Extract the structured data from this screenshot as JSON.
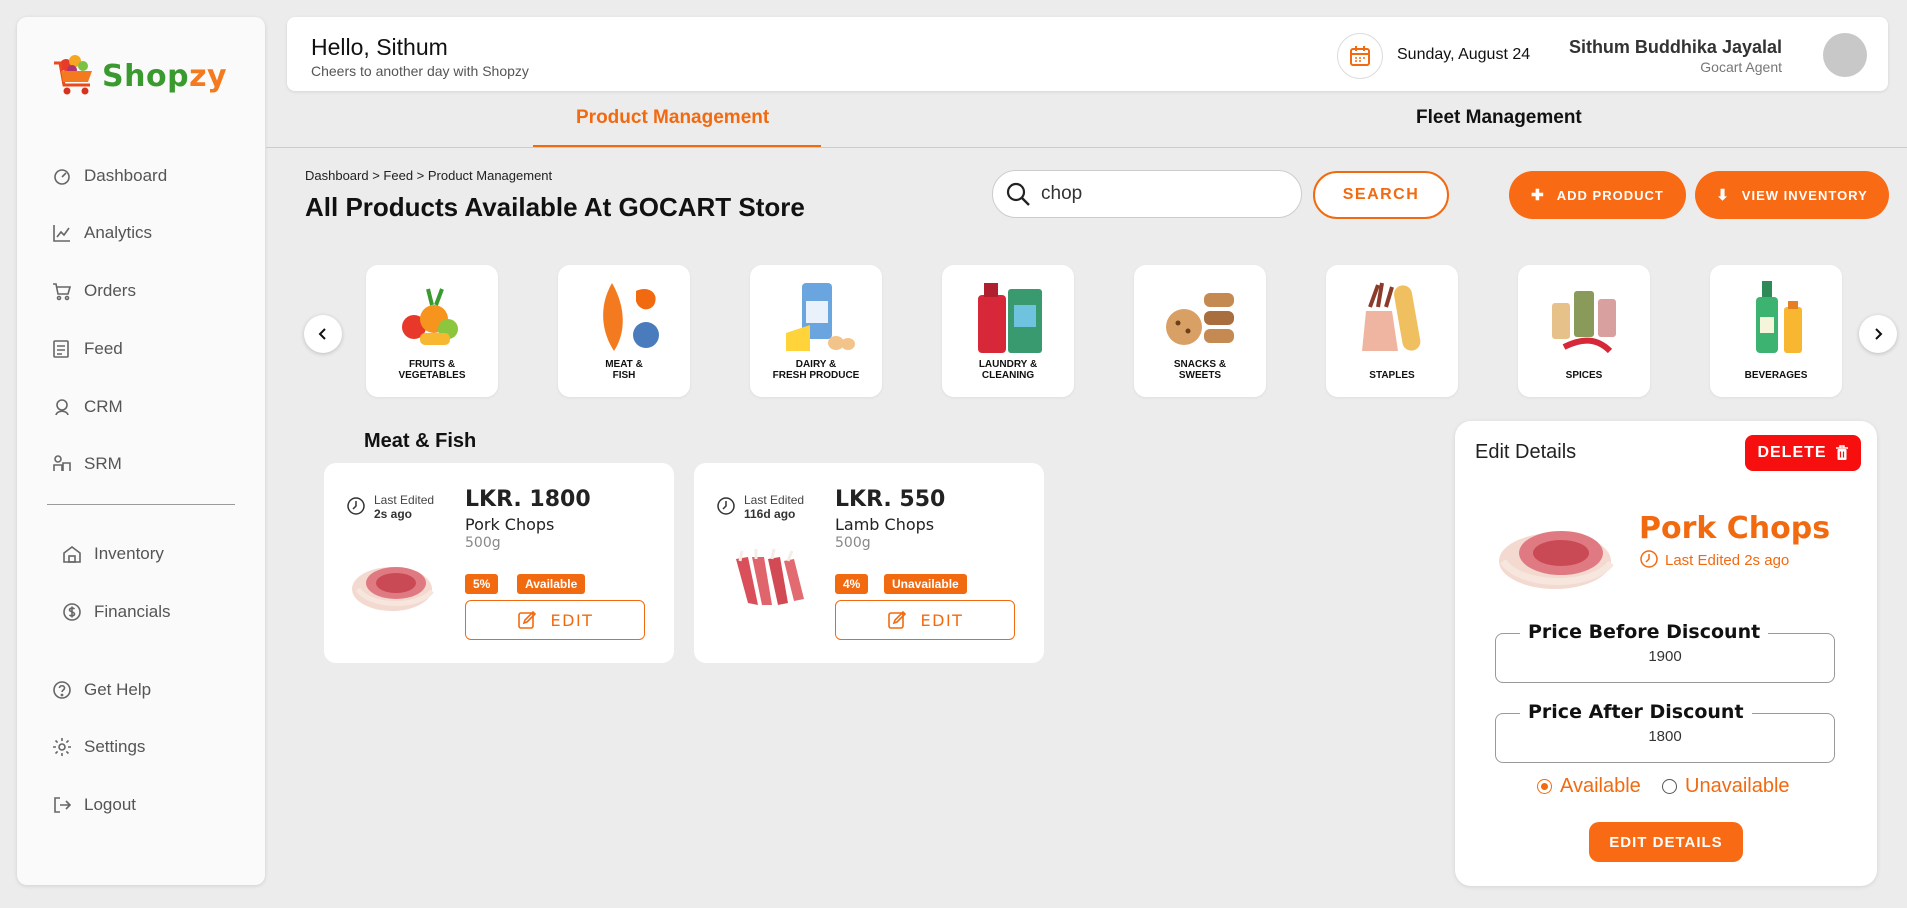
{
  "brand": {
    "name_part1": "Shop",
    "name_part2": "zy"
  },
  "sidebar": {
    "items": [
      {
        "label": "Dashboard",
        "icon": "dashboard-icon"
      },
      {
        "label": "Analytics",
        "icon": "analytics-icon"
      },
      {
        "label": "Orders",
        "icon": "orders-icon"
      },
      {
        "label": "Feed",
        "icon": "feed-icon"
      },
      {
        "label": "CRM",
        "icon": "crm-icon"
      },
      {
        "label": "SRM",
        "icon": "srm-icon"
      },
      {
        "label": "Inventory",
        "icon": "inventory-icon"
      },
      {
        "label": "Financials",
        "icon": "financials-icon"
      },
      {
        "label": "Get Help",
        "icon": "help-icon"
      },
      {
        "label": "Settings",
        "icon": "settings-icon"
      },
      {
        "label": "Logout",
        "icon": "logout-icon"
      }
    ]
  },
  "header": {
    "greeting": "Hello, Sithum",
    "subtitle": "Cheers to another day with Shopzy",
    "date": "Sunday, August 24",
    "user_name": "Sithum Buddhika Jayalal",
    "user_role": "Gocart Agent"
  },
  "tabs": [
    {
      "label": "Product Management",
      "active": true
    },
    {
      "label": "Fleet Management",
      "active": false
    }
  ],
  "breadcrumb": "Dashboard > Feed > Product Management",
  "page_title": "All Products Available At GOCART Store",
  "search": {
    "value": "chop",
    "button": "SEARCH"
  },
  "actions": {
    "add_product": "ADD PRODUCT",
    "view_inventory": "VIEW INVENTORY"
  },
  "categories": [
    {
      "label": "FRUITS &\nVEGETABLES"
    },
    {
      "label": "MEAT &\nFISH"
    },
    {
      "label": "DAIRY &\nFRESH PRODUCE"
    },
    {
      "label": "LAUNDRY &\nCLEANING"
    },
    {
      "label": "SNACKS &\nSWEETS"
    },
    {
      "label": "STAPLES"
    },
    {
      "label": "SPICES"
    },
    {
      "label": "BEVERAGES"
    }
  ],
  "section_title": "Meat & Fish",
  "products": [
    {
      "last_edited_label": "Last Edited",
      "last_edited": "2s ago",
      "price": "LKR. 1800",
      "name": "Pork Chops",
      "weight": "500g",
      "discount": "5%",
      "status": "Available",
      "edit": "EDIT"
    },
    {
      "last_edited_label": "Last Edited",
      "last_edited": "116d ago",
      "price": "LKR. 550",
      "name": "Lamb Chops",
      "weight": "500g",
      "discount": "4%",
      "status": "Unavailable",
      "edit": "EDIT"
    }
  ],
  "edit_panel": {
    "title": "Edit Details",
    "delete": "DELETE",
    "product_name": "Pork Chops",
    "last_edited": "Last Edited 2s ago",
    "price_before_label": "Price Before Discount",
    "price_before": "1900",
    "price_after_label": "Price After Discount",
    "price_after": "1800",
    "available": "Available",
    "unavailable": "Unavailable",
    "selected": "Available",
    "submit": "EDIT DETAILS"
  },
  "colors": {
    "accent": "#f26a0f",
    "danger": "#f70f0f",
    "brand_green": "#3a9a2f"
  }
}
